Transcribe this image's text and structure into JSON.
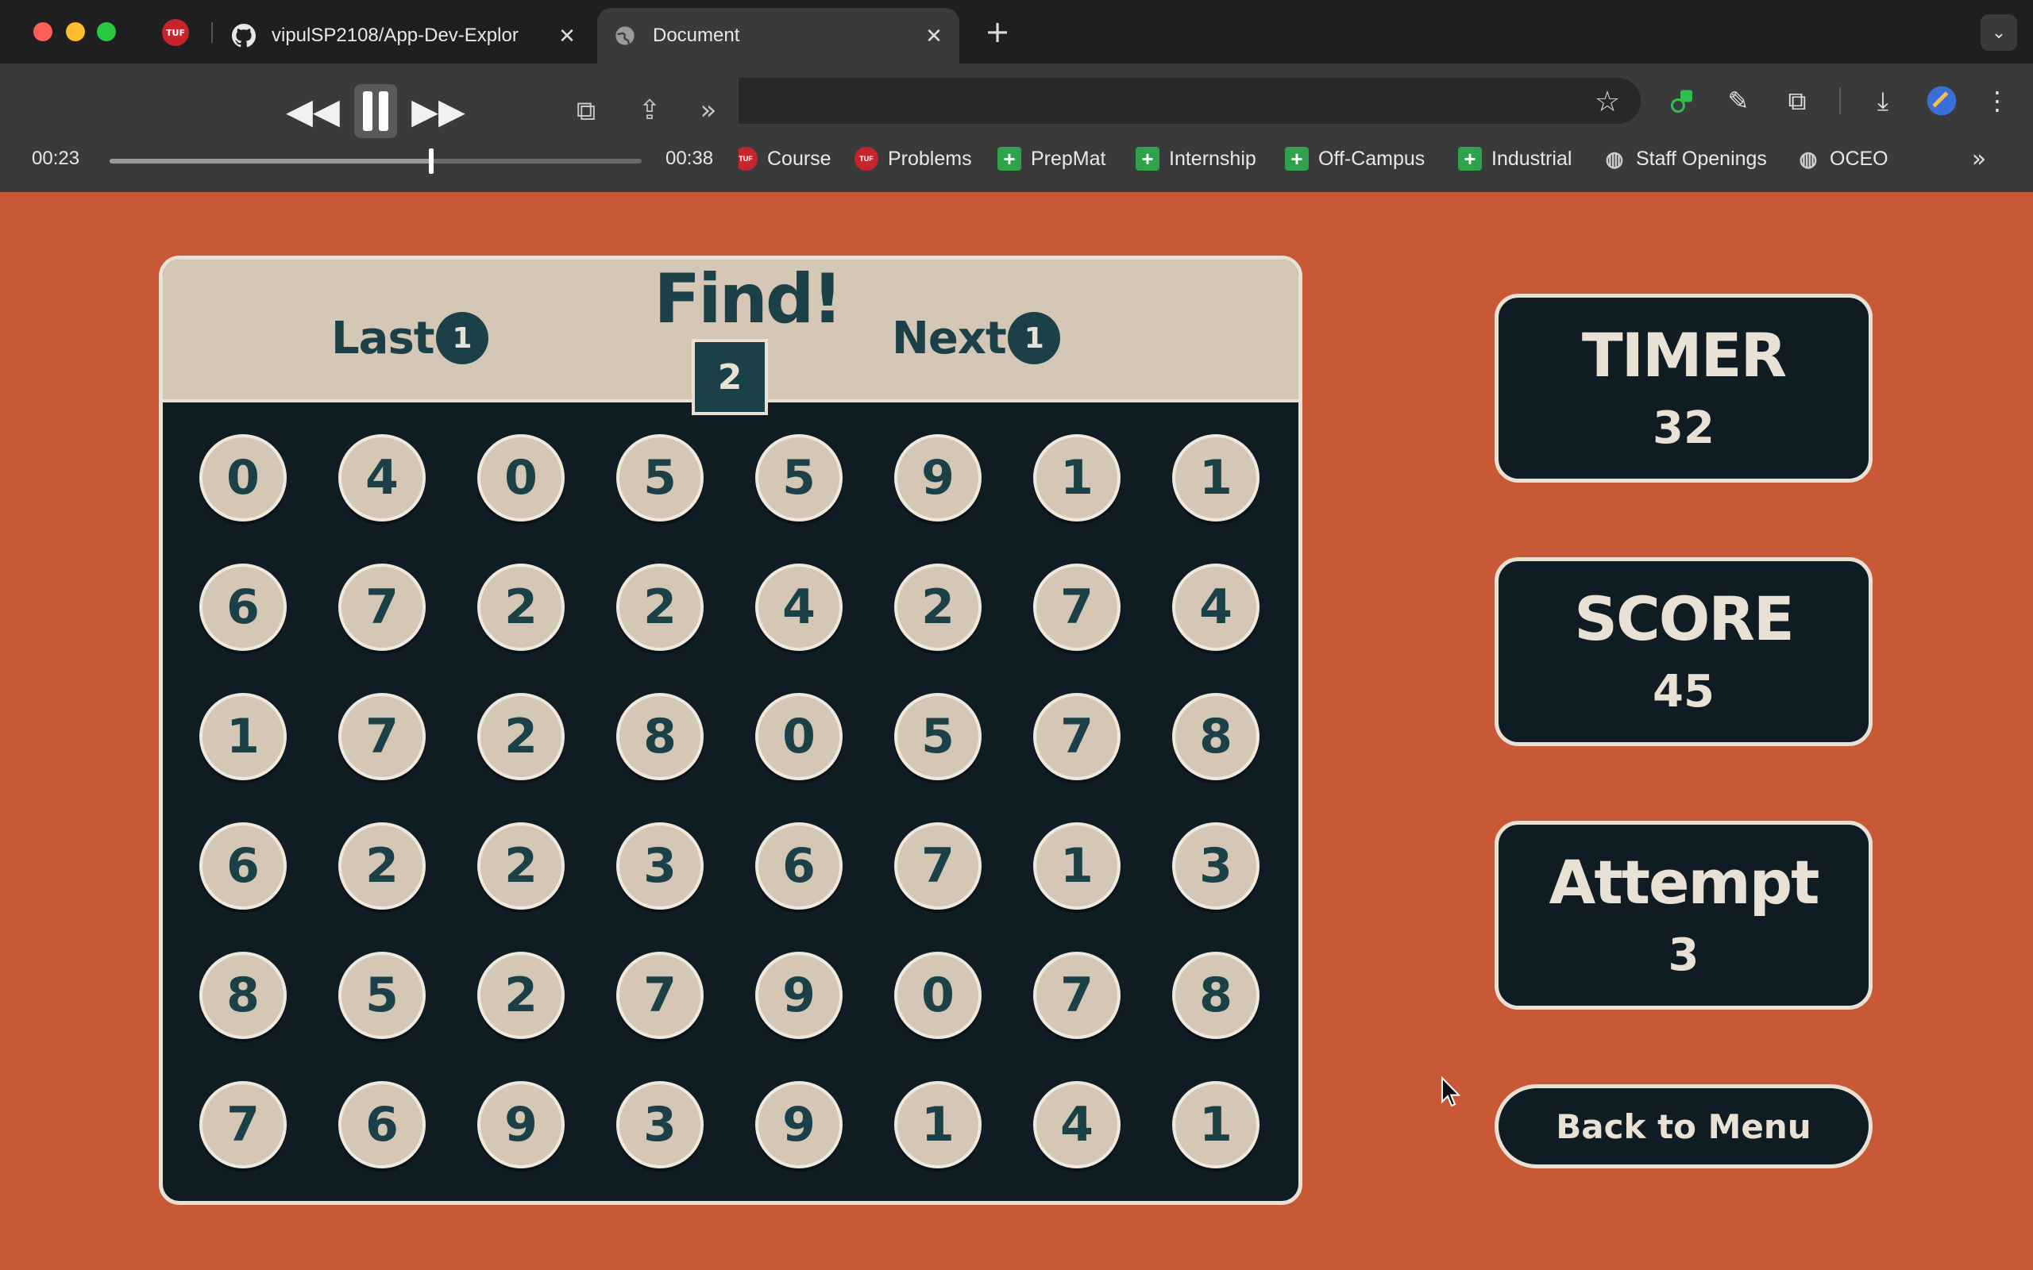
{
  "browser": {
    "tabs": [
      {
        "title": "vipulSP2108/App-Dev-Explor",
        "icon": "github-icon"
      },
      {
        "title": "Document",
        "icon": "globe-icon",
        "active": true
      }
    ],
    "pinned_tab_icon": "tuf-icon",
    "bookmarks": [
      {
        "label": "Course",
        "icon": "tuf-icon"
      },
      {
        "label": "Problems",
        "icon": "tuf-icon"
      },
      {
        "label": "PrepMat",
        "icon": "plus-folder-icon"
      },
      {
        "label": "Internship",
        "icon": "plus-folder-icon"
      },
      {
        "label": "Off-Campus",
        "icon": "plus-folder-icon"
      },
      {
        "label": "Industrial",
        "icon": "plus-folder-icon"
      },
      {
        "label": "Staff Openings",
        "icon": "globe-icon"
      },
      {
        "label": "OCEO",
        "icon": "globe-icon"
      }
    ]
  },
  "media": {
    "current_time": "00:23",
    "duration": "00:38",
    "progress": 0.605
  },
  "game": {
    "last_label": "Last",
    "last_value": "1",
    "find_label": "Find!",
    "find_value": "2",
    "next_label": "Next",
    "next_value": "1",
    "grid": [
      [
        "0",
        "4",
        "0",
        "5",
        "5",
        "9",
        "1",
        "1"
      ],
      [
        "6",
        "7",
        "2",
        "2",
        "4",
        "2",
        "7",
        "4"
      ],
      [
        "1",
        "7",
        "2",
        "8",
        "0",
        "5",
        "7",
        "8"
      ],
      [
        "6",
        "2",
        "2",
        "3",
        "6",
        "7",
        "1",
        "3"
      ],
      [
        "8",
        "5",
        "2",
        "7",
        "9",
        "0",
        "7",
        "8"
      ],
      [
        "7",
        "6",
        "9",
        "3",
        "9",
        "1",
        "4",
        "1"
      ]
    ],
    "timer_label": "TIMER",
    "timer_value": "32",
    "score_label": "SCORE",
    "score_value": "45",
    "attempt_label": "Attempt",
    "attempt_value": "3",
    "back_label": "Back to Menu"
  },
  "colors": {
    "page_bg": "#c95836",
    "board_bg": "#0f1c24",
    "tile": "#d4c7b5",
    "accent_text": "#1c4048"
  }
}
